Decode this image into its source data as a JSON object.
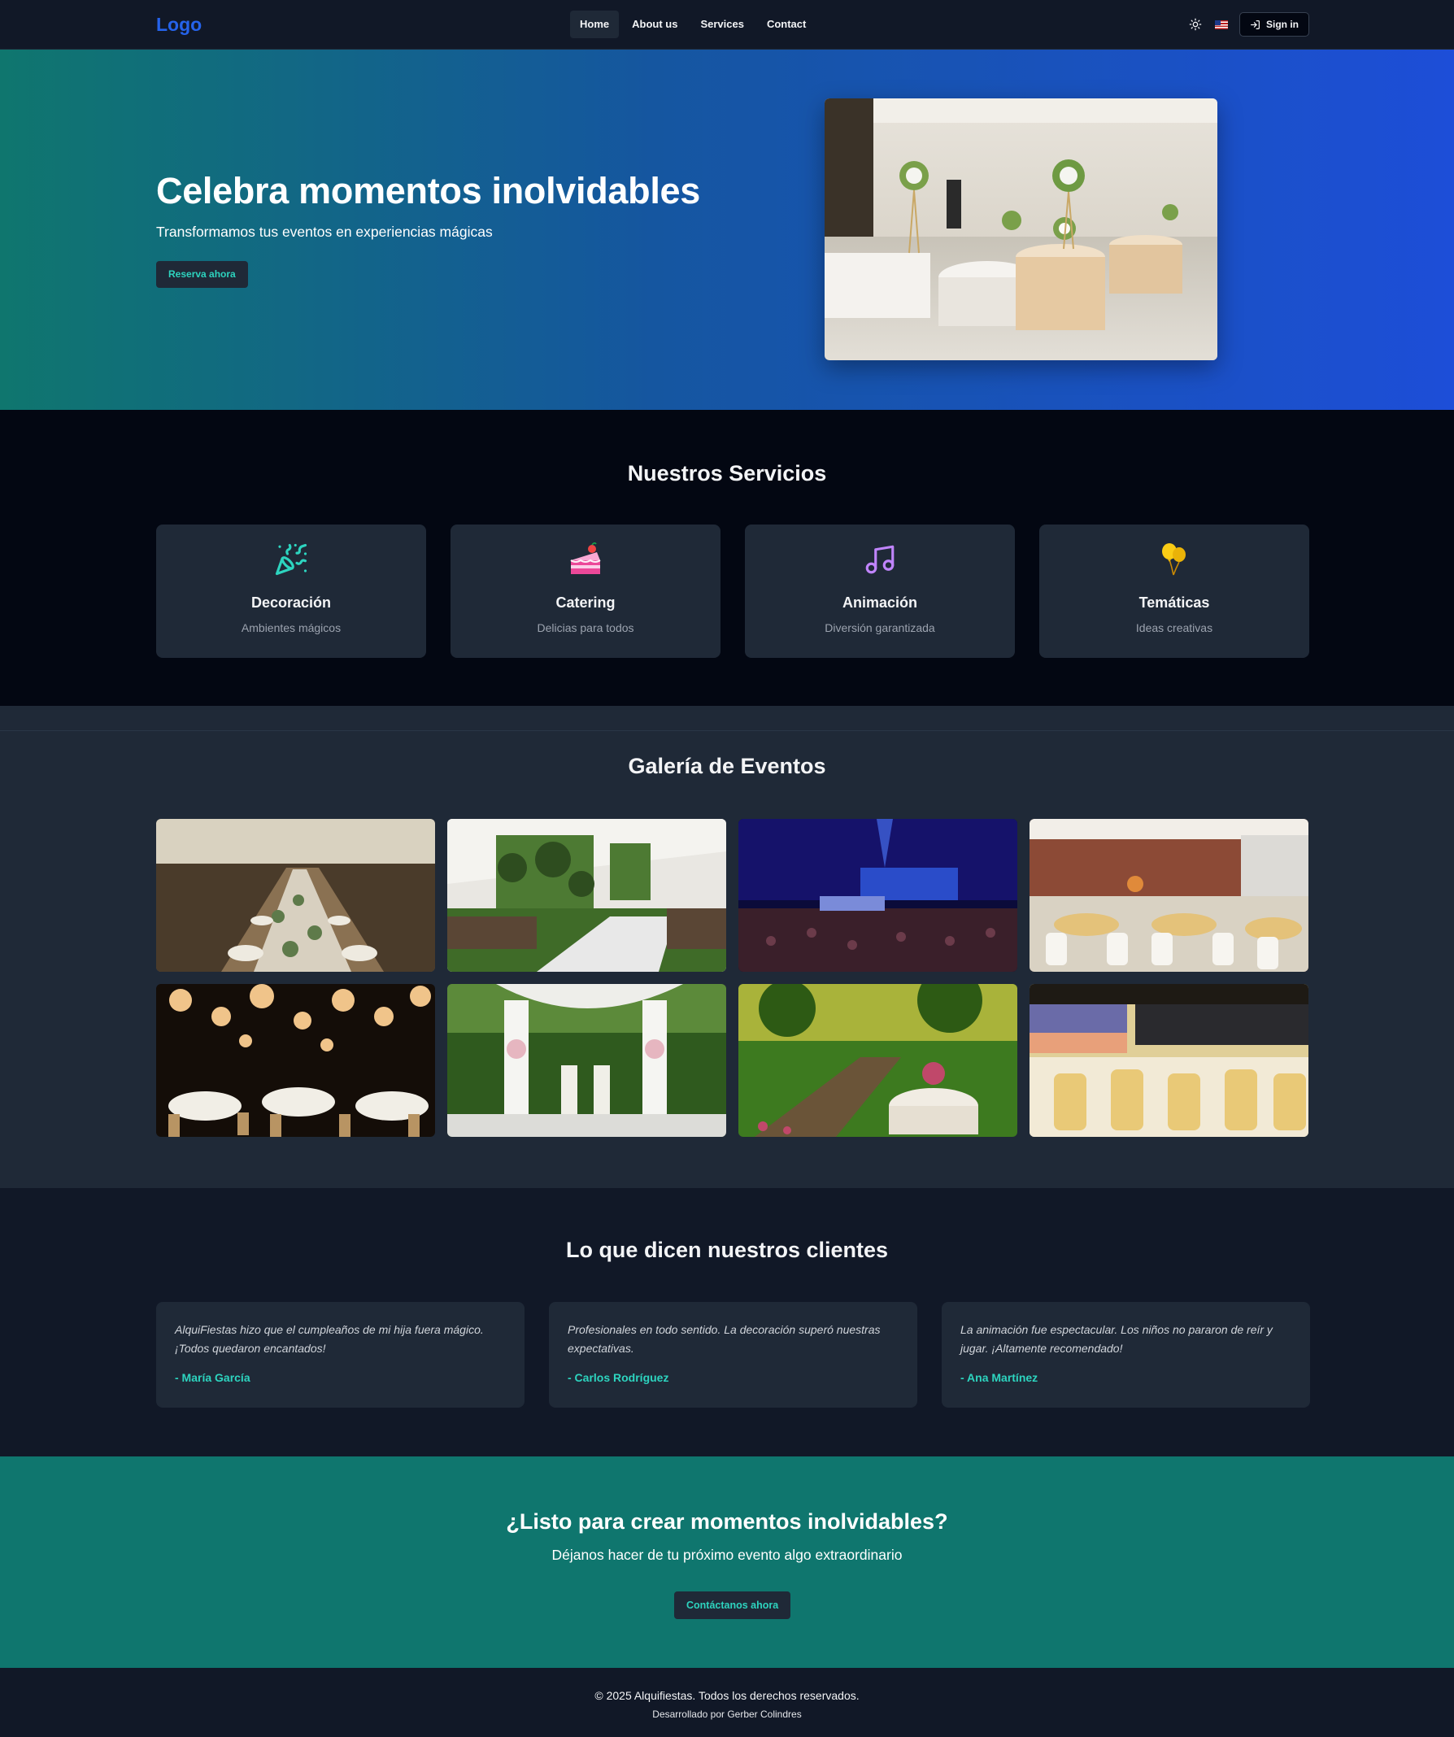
{
  "nav": {
    "logo": "Logo",
    "links": [
      {
        "label": "Home",
        "active": true
      },
      {
        "label": "About us"
      },
      {
        "label": "Services"
      },
      {
        "label": "Contact"
      }
    ],
    "theme_icon": "sun-icon",
    "language_icon": "us-flag-icon",
    "signin_icon": "sign-in-icon",
    "signin_label": "Sign in"
  },
  "hero": {
    "title": "Celebra momentos inolvidables",
    "subtitle": "Transformamos tus eventos en experiencias mágicas",
    "cta": "Reserva ahora",
    "image": "banquet-hall-photo"
  },
  "services": {
    "title": "Nuestros Servicios",
    "items": [
      {
        "icon": "party-popper-icon",
        "title": "Decoración",
        "subtitle": "Ambientes mágicos",
        "color": "#2dd4bf"
      },
      {
        "icon": "cake-slice-icon",
        "title": "Catering",
        "subtitle": "Delicias para todos",
        "color": "#f472b6"
      },
      {
        "icon": "music-note-icon",
        "title": "Animación",
        "subtitle": "Diversión garantizada",
        "color": "#c084fc"
      },
      {
        "icon": "balloons-icon",
        "title": "Temáticas",
        "subtitle": "Ideas creativas",
        "color": "#facc15"
      }
    ]
  },
  "gallery": {
    "title": "Galería de Eventos",
    "images": [
      "long-banquet-table-photo",
      "garden-tent-greenery-photo",
      "concert-stage-photo",
      "gold-chair-hall-photo",
      "lanterns-reception-photo",
      "white-drape-ceremony-photo",
      "garden-dining-photo",
      "sunset-terrace-hall-photo"
    ]
  },
  "testimonials": {
    "title": "Lo que dicen nuestros clientes",
    "items": [
      {
        "quote": "AlquiFiestas hizo que el cumpleaños de mi hija fuera mágico. ¡Todos quedaron encantados!",
        "author": "- María García"
      },
      {
        "quote": "Profesionales en todo sentido. La decoración superó nuestras expectativas.",
        "author": "- Carlos Rodríguez"
      },
      {
        "quote": "La animación fue espectacular. Los niños no pararon de reír y jugar. ¡Altamente recomendado!",
        "author": "- Ana Martínez"
      }
    ]
  },
  "cta": {
    "title": "¿Listo para crear momentos inolvidables?",
    "subtitle": "Déjanos hacer de tu próximo evento algo extraordinario",
    "button": "Contáctanos ahora"
  },
  "footer": {
    "copyright": "© 2025 Alquifiestas. Todos los derechos reservados.",
    "developer": "Desarrollado por Gerber Colindres"
  }
}
